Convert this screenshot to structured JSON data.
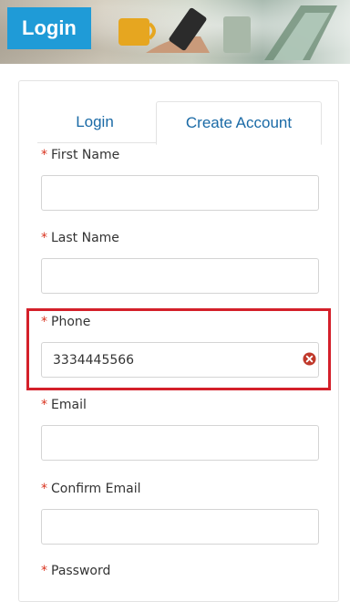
{
  "header": {
    "title": "Login"
  },
  "tabs": [
    {
      "label": "Login",
      "active": false
    },
    {
      "label": "Create Account",
      "active": true
    }
  ],
  "form": {
    "required_marker": "*",
    "fields": [
      {
        "label": "First Name",
        "value": ""
      },
      {
        "label": "Last Name",
        "value": ""
      },
      {
        "label": "Phone",
        "value": "3334445566"
      },
      {
        "label": "Email",
        "value": ""
      },
      {
        "label": "Confirm Email",
        "value": ""
      },
      {
        "label": "Password",
        "value": ""
      }
    ]
  },
  "colors": {
    "header_bg": "#1f9bd7",
    "tab_text": "#1a6aa6",
    "required": "#d9331f",
    "highlight_border": "#d4202a",
    "clear_icon": "#c0392b"
  },
  "icons": {
    "clear": "clear-x-circle-icon"
  }
}
